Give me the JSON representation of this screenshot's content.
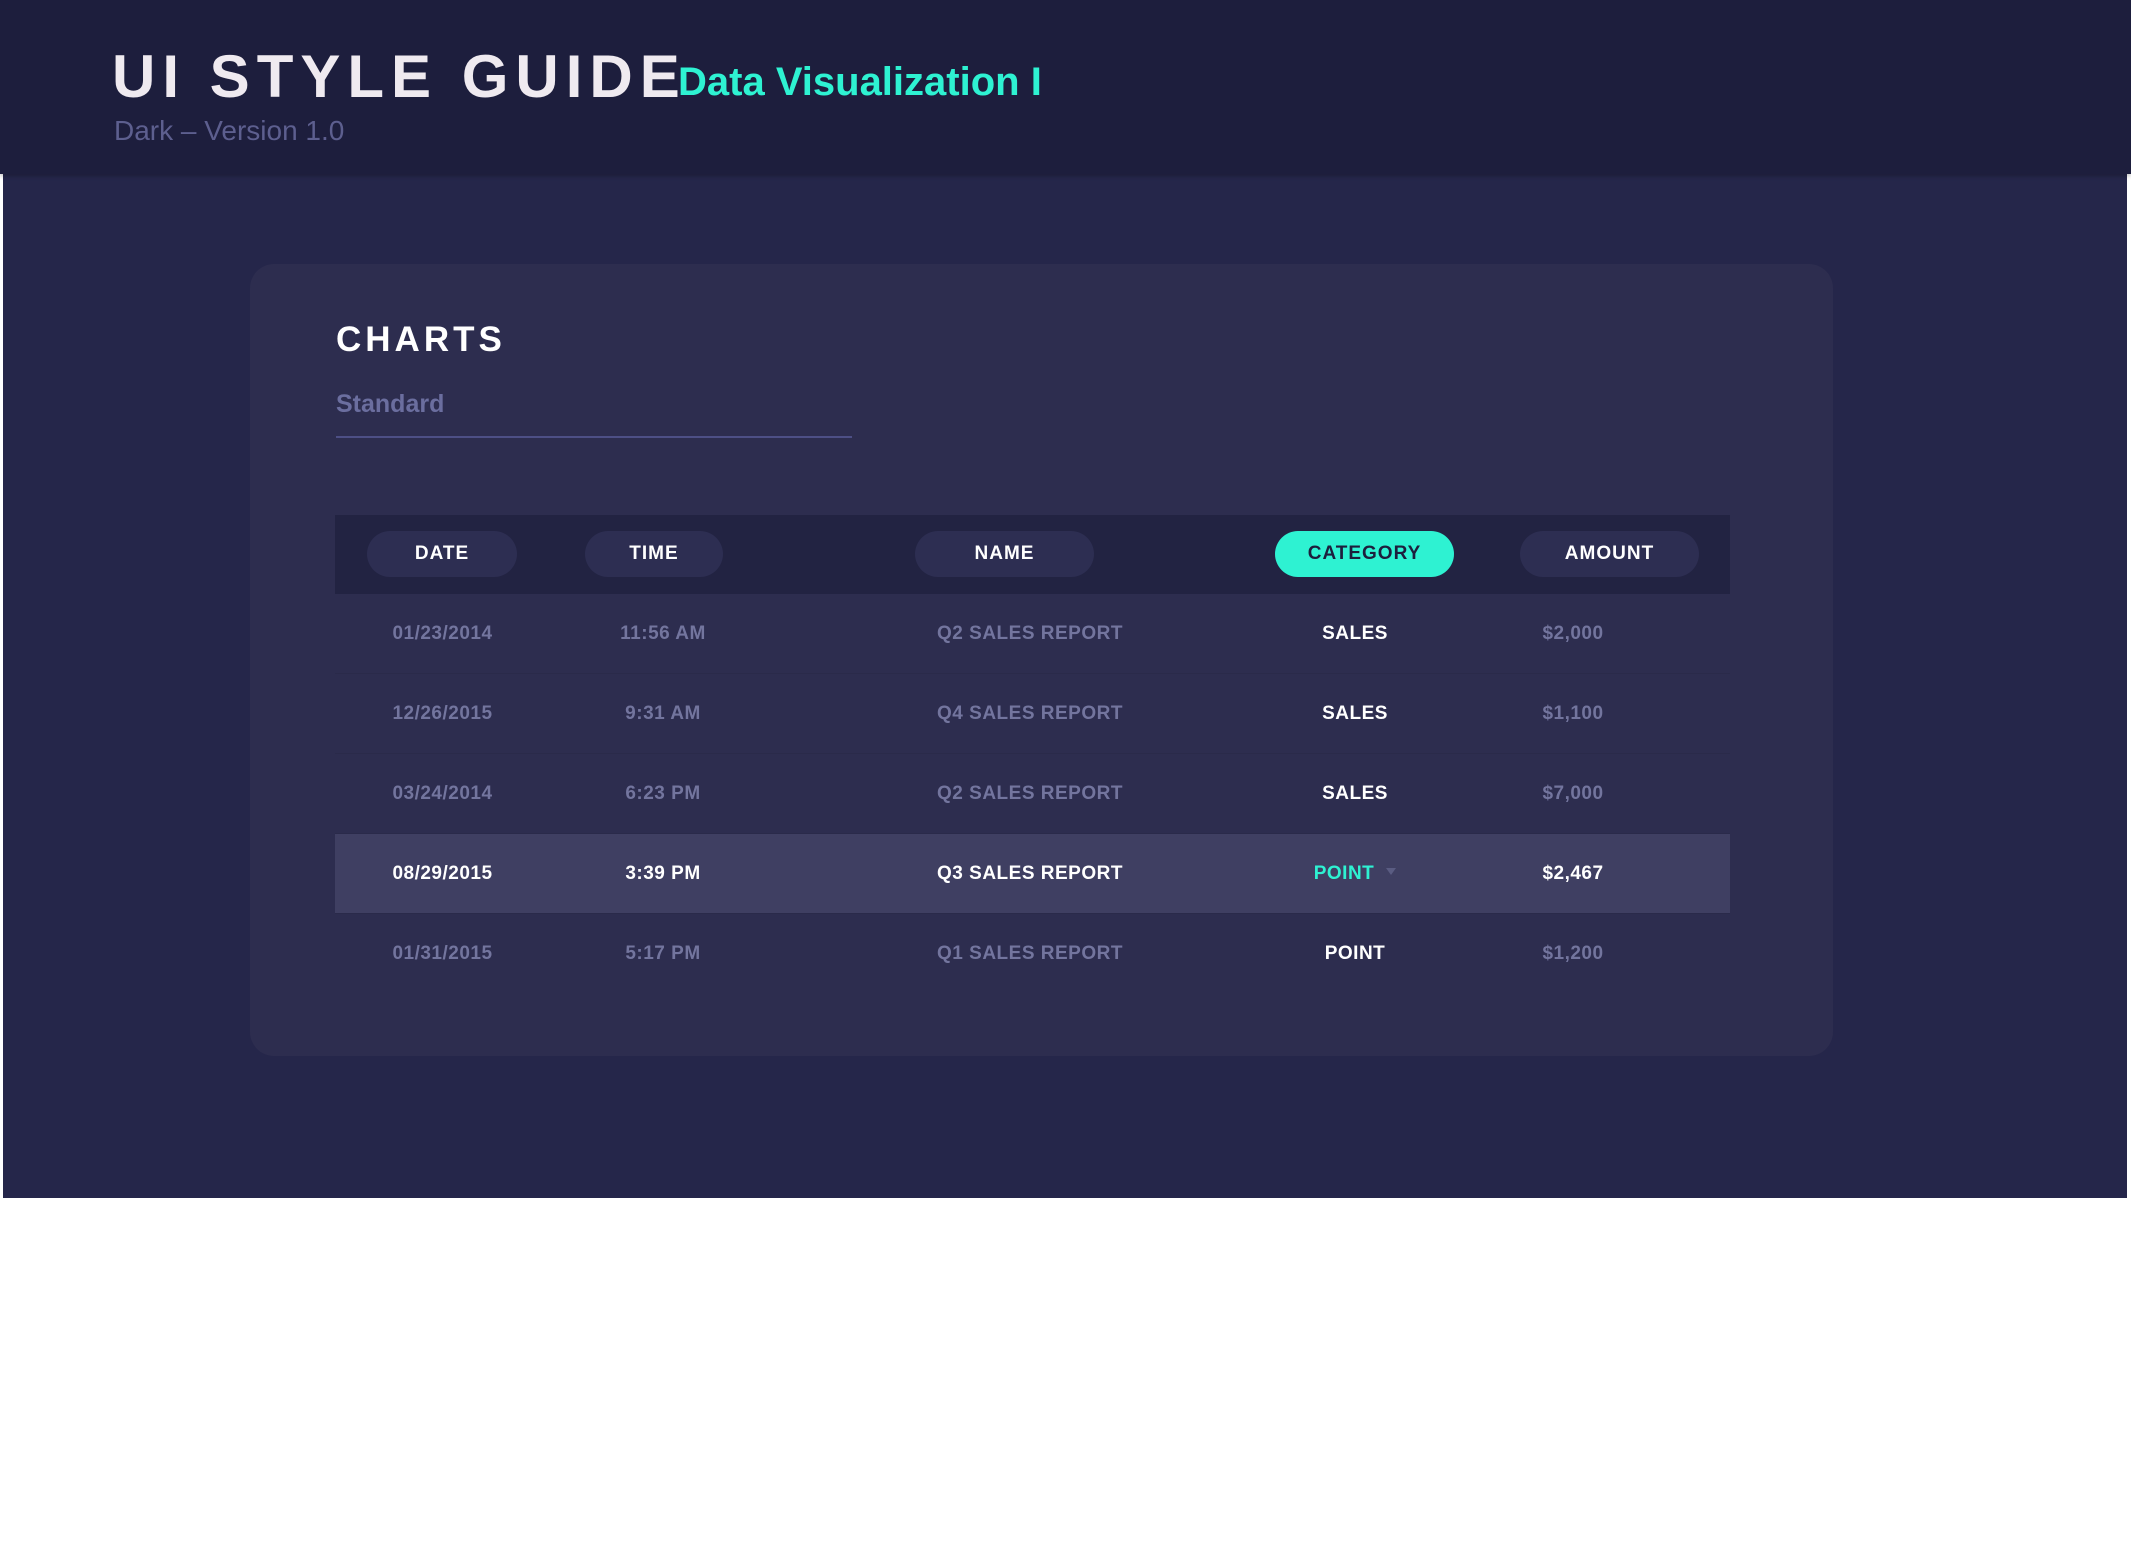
{
  "header": {
    "title": "UI STYLE GUIDE",
    "subtitle": "Data Visualization I",
    "version": "Dark – Version 1.0"
  },
  "section": {
    "title": "CHARTS",
    "tab": "Standard"
  },
  "table": {
    "columns": [
      "DATE",
      "TIME",
      "NAME",
      "CATEGORY",
      "AMOUNT"
    ],
    "active_column": "CATEGORY",
    "rows": [
      {
        "date": "01/23/2014",
        "time": "11:56 AM",
        "name": "Q2 SALES REPORT",
        "category": "SALES",
        "amount": "$2,000"
      },
      {
        "date": "12/26/2015",
        "time": "9:31 AM",
        "name": "Q4 SALES REPORT",
        "category": "SALES",
        "amount": "$1,100"
      },
      {
        "date": "03/24/2014",
        "time": "6:23 PM",
        "name": "Q2 SALES REPORT",
        "category": "SALES",
        "amount": "$7,000"
      },
      {
        "date": "08/29/2015",
        "time": "3:39 PM",
        "name": "Q3 SALES REPORT",
        "category": "POINT",
        "amount": "$2,467"
      },
      {
        "date": "01/31/2015",
        "time": "5:17 PM",
        "name": "Q1 SALES REPORT",
        "category": "POINT",
        "amount": "$1,200"
      }
    ],
    "highlighted_row": 3
  },
  "colors": {
    "accent": "#2ef2d2",
    "background": "#25264a",
    "topbar": "#1d1e3d",
    "card": "#2d2d4f",
    "highlight_row": "#3f3f62",
    "muted_text": "#73759e"
  },
  "icons": {
    "row_dropdown": "caret-down-icon"
  }
}
